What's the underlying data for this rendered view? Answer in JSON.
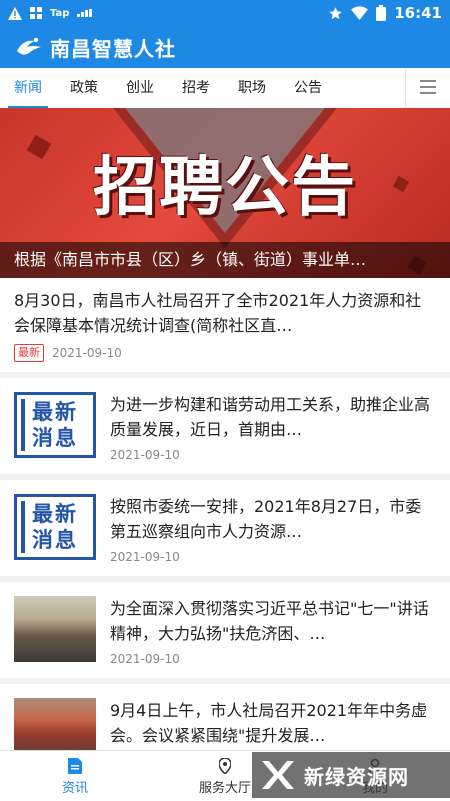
{
  "status_bar": {
    "time": "16:41",
    "left_icons": [
      "warning-icon",
      "grid-icon",
      "tap-icon",
      "signal-small-icon"
    ],
    "tap_label": "Tap",
    "right_icons": [
      "star-icon",
      "wifi-icon",
      "battery-icon"
    ]
  },
  "header": {
    "title": "南昌智慧人社"
  },
  "tabs": [
    {
      "label": "新闻",
      "active": true
    },
    {
      "label": "政策"
    },
    {
      "label": "创业"
    },
    {
      "label": "招考"
    },
    {
      "label": "职场"
    },
    {
      "label": "公告"
    }
  ],
  "banner": {
    "headline": "招聘公告",
    "caption": "根据《南昌市市县（区）乡（镇、街道）事业单…"
  },
  "news": [
    {
      "title": "8月30日，南昌市人社局召开了全市2021年人力资源和社会保障基本情况统计调查(简称社区直…",
      "badge": "最新",
      "date": "2021-09-10"
    },
    {
      "thumb_text": [
        "最新",
        "消息"
      ],
      "title": "为进一步构建和谐劳动用工关系，助推企业高质量发展，近日，首期由…",
      "date": "2021-09-10"
    },
    {
      "thumb_text": [
        "最新",
        "消息"
      ],
      "title": " 按照市委统一安排，2021年8月27日，市委第五巡察组向市人力资源…",
      "date": "2021-09-10"
    },
    {
      "title": "为全面深入贯彻落实习近平总书记\"七一\"讲话精神，大力弘扬\"扶危济困、…",
      "date": "2021-09-10"
    },
    {
      "title": " 9月4日上午，市人社局召开2021年年中务虚会。会议紧紧围绕\"提升发展…"
    }
  ],
  "bottom_nav": [
    {
      "label": "资讯",
      "icon": "news-icon",
      "active": true
    },
    {
      "label": "服务大厅",
      "icon": "location-icon"
    },
    {
      "label": "我的",
      "icon": "user-icon"
    }
  ],
  "watermark": {
    "text": "新绿资源网"
  },
  "colors": {
    "primary": "#1e88e5",
    "banner_red": "#d9362b",
    "badge_red": "#e53935",
    "thumb_blue": "#2456a8"
  }
}
